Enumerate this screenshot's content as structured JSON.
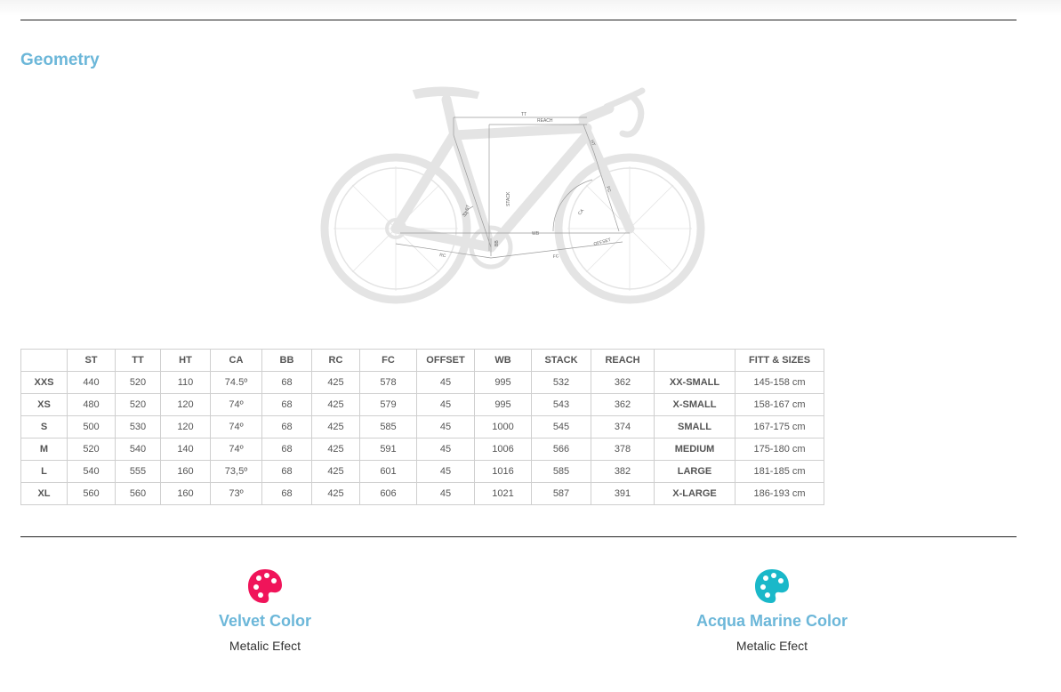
{
  "section_title": "Geometry",
  "diagram_labels": {
    "tt": "TT",
    "reach": "REACH",
    "ht": "HT",
    "stack": "STACK",
    "st": "ST",
    "ca": "CA",
    "sa": "SA",
    "bb": "BB",
    "wb": "WB",
    "rc": "RC",
    "fc": "FC",
    "offset": "OFFSET"
  },
  "table": {
    "headers": [
      "",
      "ST",
      "TT",
      "HT",
      "CA",
      "BB",
      "RC",
      "FC",
      "OFFSET",
      "WB",
      "STACK",
      "REACH",
      "",
      "FITT & SIZES"
    ],
    "rows": [
      [
        "XXS",
        "440",
        "520",
        "110",
        "74.5º",
        "68",
        "425",
        "578",
        "45",
        "995",
        "532",
        "362",
        "XX-SMALL",
        "145-158 cm"
      ],
      [
        "XS",
        "480",
        "520",
        "120",
        "74º",
        "68",
        "425",
        "579",
        "45",
        "995",
        "543",
        "362",
        "X-SMALL",
        "158-167 cm"
      ],
      [
        "S",
        "500",
        "530",
        "120",
        "74º",
        "68",
        "425",
        "585",
        "45",
        "1000",
        "545",
        "374",
        "SMALL",
        "167-175 cm"
      ],
      [
        "M",
        "520",
        "540",
        "140",
        "74º",
        "68",
        "425",
        "591",
        "45",
        "1006",
        "566",
        "378",
        "MEDIUM",
        "175-180 cm"
      ],
      [
        "L",
        "540",
        "555",
        "160",
        "73,5º",
        "68",
        "425",
        "601",
        "45",
        "1016",
        "585",
        "382",
        "LARGE",
        "181-185 cm"
      ],
      [
        "XL",
        "560",
        "560",
        "160",
        "73º",
        "68",
        "425",
        "606",
        "45",
        "1021",
        "587",
        "391",
        "X-LARGE",
        "186-193 cm"
      ]
    ]
  },
  "colors": [
    {
      "name": "Velvet Color",
      "finish": "Metalic Efect",
      "swatch": "#f0145a",
      "icon": "palette-icon"
    },
    {
      "name": "Acqua Marine Color",
      "finish": "Metalic Efect",
      "swatch": "#1ab8c9",
      "icon": "palette-icon"
    }
  ],
  "accent_color": "#6cb7d9"
}
